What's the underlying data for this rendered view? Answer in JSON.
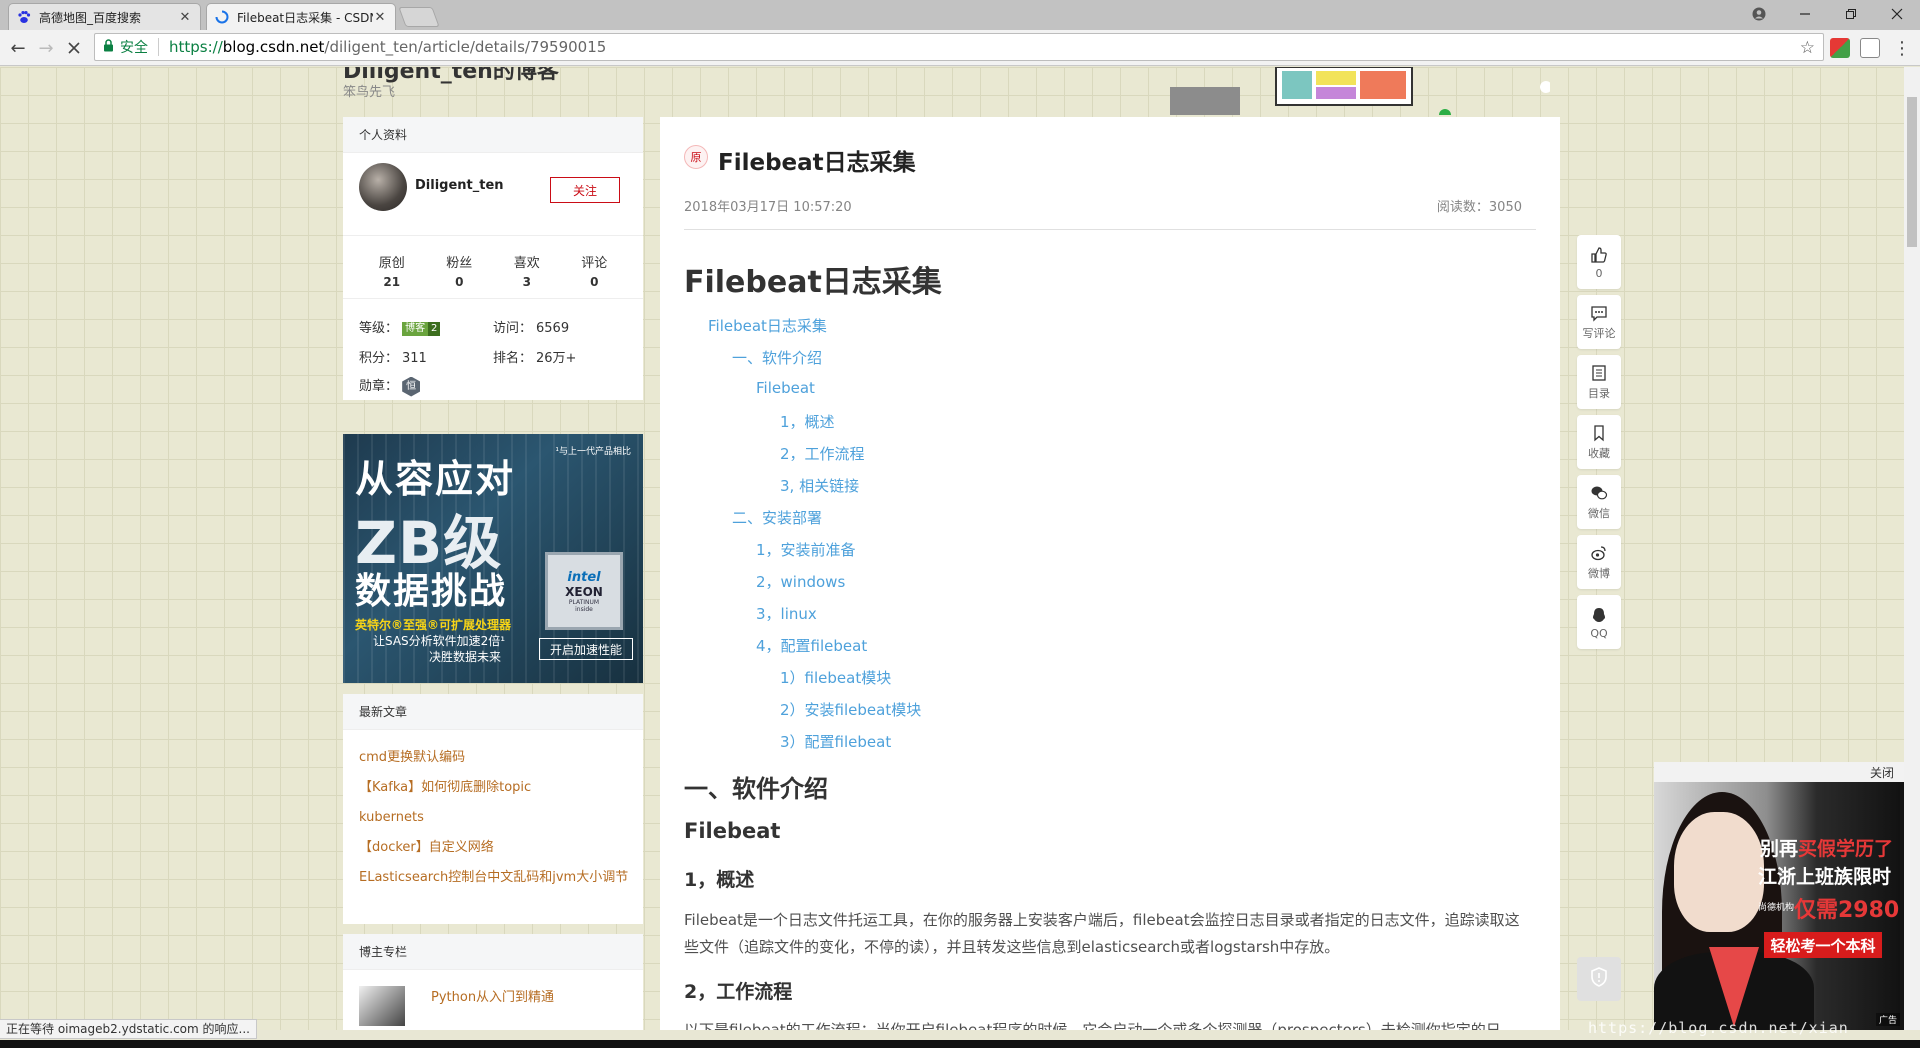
{
  "browser": {
    "tabs": [
      {
        "title": "高德地图_百度搜索",
        "active": false
      },
      {
        "title": "Filebeat日志采集 - CSDN",
        "active": true
      }
    ],
    "secure_label": "安全",
    "url": {
      "scheme": "https://",
      "host": "blog.csdn.net",
      "path": "/diligent_ten/article/details/79590015"
    },
    "status_text": "正在等待 oimageb2.ydstatic.com 的响应..."
  },
  "blog": {
    "title": "Diligent_ten的博客",
    "subtitle": "笨鸟先飞"
  },
  "profile_card": {
    "header": "个人资料",
    "username": "Diligent_ten",
    "follow_label": "关注",
    "stats": [
      {
        "label": "原创",
        "value": "21"
      },
      {
        "label": "粉丝",
        "value": "0"
      },
      {
        "label": "喜欢",
        "value": "3"
      },
      {
        "label": "评论",
        "value": "0"
      }
    ],
    "level_label": "等级：",
    "level_badge": "博客",
    "level_num": "2",
    "visits_label": "访问：",
    "visits_value": "6569",
    "points_label": "积分：",
    "points_value": "311",
    "rank_label": "排名：",
    "rank_value": "26万+",
    "medal_label": "勋章：",
    "medal_badge": "恒"
  },
  "sidebar_ad": {
    "line1": "从容应对",
    "line2": "ZB级",
    "line3": "数据挑战",
    "line4": "英特尔®至强®可扩展处理器",
    "line5": "让SAS分析软件加速2倍¹",
    "line6": "决胜数据未来",
    "note": "¹与上一代产品相比",
    "chip_brand": "intel",
    "chip_name": "XEON",
    "chip_tier": "PLATINUM",
    "chip_inside": "inside",
    "cta": "开启加速性能"
  },
  "recent": {
    "header": "最新文章",
    "items": [
      "cmd更换默认编码",
      "【Kafka】如何彻底删除topic",
      "kubernets",
      "【docker】自定义网络",
      "ELasticsearch控制台中文乱码和jvm大小调节"
    ]
  },
  "column": {
    "header": "博主专栏",
    "item": "Python从入门到精通"
  },
  "article": {
    "origin_tag": "原",
    "title": "Filebeat日志采集",
    "date": "2018年03月17日 10:57:20",
    "reads": "阅读数：3050",
    "h1": "Filebeat日志采集",
    "toc": [
      "Filebeat日志采集",
      "一、软件介绍",
      "Filebeat",
      "1，概述",
      "2，工作流程",
      "3, 相关链接",
      "二、安装部署",
      "1，安装前准备",
      "2，windows",
      "3，linux",
      "4，配置filebeat",
      "1）filebeat模块",
      "2）安装filebeat模块",
      "3）配置filebeat"
    ],
    "sec1": "一、软件介绍",
    "sec1_sub": "Filebeat",
    "sec1_1": "1，概述",
    "para1": "Filebeat是一个日志文件托运工具，在你的服务器上安装客户端后，filebeat会监控日志目录或者指定的日志文件，追踪读取这些文件（追踪文件的变化，不停的读），并且转发这些信息到elasticsearch或者logstarsh中存放。",
    "sec1_2": "2，工作流程",
    "para2": "以下是filebeat的工作流程：当你开启filebeat程序的时候，它会启动一个或多个探测器（prospectors）去检测你指定的日"
  },
  "toolbar_right": {
    "like_count": "0",
    "comment": "写评论",
    "toc": "目录",
    "fav": "收藏",
    "wechat": "微信",
    "weibo": "微博",
    "qq": "QQ"
  },
  "right_ad": {
    "close": "关闭",
    "l1a": "别再",
    "l1b": "买假学历了",
    "l2": "江浙上班族限时",
    "l3": "仅需2980",
    "l3b": "尚德机构",
    "l4": "轻松考一个本科",
    "tag": "广告"
  },
  "watermark": "https://blog.csdn.net/xian"
}
